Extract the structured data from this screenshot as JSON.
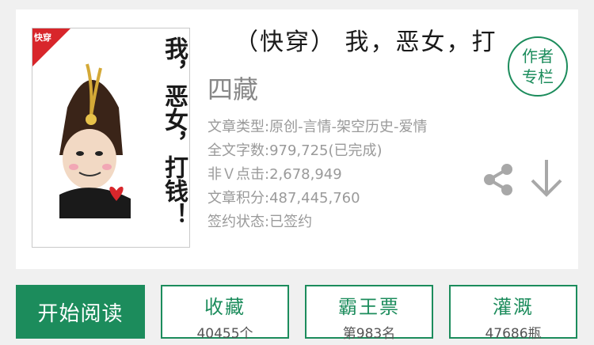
{
  "book": {
    "title": "（快穿） 我，恶女，打",
    "author": "四藏",
    "cover": {
      "tag": "快穿",
      "calligraphy": "我，恶女，打钱！"
    },
    "meta": {
      "type": "文章类型:原创-言情-架空历史-爱情",
      "word_count": "全文字数:979,725(已完成)",
      "clicks": "非Ｖ点击:2,678,949",
      "score": "文章积分:487,445,760",
      "contract": "签约状态:已签约"
    }
  },
  "author_column": {
    "line1": "作者",
    "line2": "专栏"
  },
  "icons": {
    "share": "share-icon",
    "download": "download-icon"
  },
  "actions": {
    "read": "开始阅读",
    "stats": [
      {
        "label": "收藏",
        "value": "40455个"
      },
      {
        "label": "霸王票",
        "value": "第983名"
      },
      {
        "label": "灌溉",
        "value": "47686瓶"
      }
    ]
  },
  "colors": {
    "accent": "#1c8c5c",
    "meta_text": "#9a9a9a",
    "tag": "#d8262b"
  }
}
